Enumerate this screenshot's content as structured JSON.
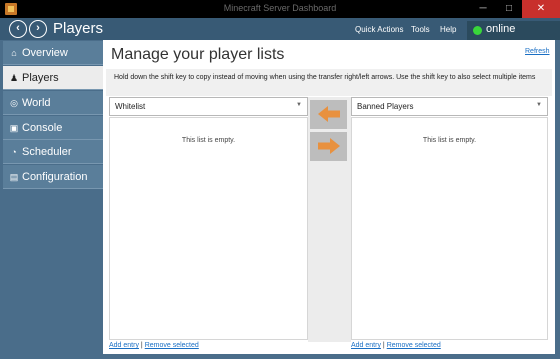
{
  "window": {
    "title": "Minecraft Server Dashboard",
    "minimize": "─",
    "maximize": "□",
    "close": "✕"
  },
  "header": {
    "title": "Players",
    "back_icon": "arrow-left-circle-icon",
    "forward_icon": "arrow-right-circle-icon",
    "menu": [
      "Quick Actions",
      "Tools",
      "Help"
    ],
    "status": {
      "text": "online",
      "color": "#39d63a"
    }
  },
  "sidebar": {
    "items": [
      {
        "label": "Overview",
        "icon": "home-icon",
        "glyph": "⌂"
      },
      {
        "label": "Players",
        "icon": "user-icon",
        "glyph": "♟"
      },
      {
        "label": "World",
        "icon": "globe-icon",
        "glyph": "◎"
      },
      {
        "label": "Console",
        "icon": "console-icon",
        "glyph": "▣"
      },
      {
        "label": "Scheduler",
        "icon": "clock-icon",
        "glyph": "◔"
      },
      {
        "label": "Configuration",
        "icon": "document-icon",
        "glyph": "▤"
      }
    ],
    "active": "Players"
  },
  "main": {
    "title": "Manage your player lists",
    "refresh": "Refresh",
    "instructions": "Hold down the shift key to copy instead of moving when using the transfer right/left arrows. Use the shift key to also select multiple items",
    "left_list": {
      "selected": "Whitelist",
      "empty_text": "This list is empty."
    },
    "right_list": {
      "selected": "Banned Players",
      "empty_text": "This list is empty."
    },
    "add_entry": "Add entry",
    "separator": "|",
    "remove_selected": "Remove selected"
  },
  "colors": {
    "accent": "#385a75",
    "arrow": "#e8913f",
    "link": "#1a6fc4"
  }
}
